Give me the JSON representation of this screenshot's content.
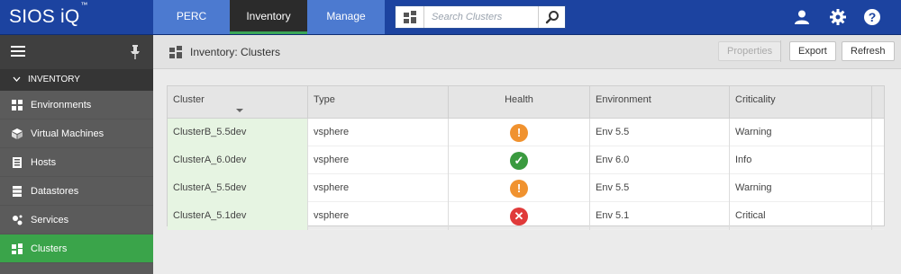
{
  "app": {
    "brand": "SIOS iQ",
    "brand_tm": "™"
  },
  "nav": {
    "tabs": [
      {
        "label": "PERC"
      },
      {
        "label": "Inventory"
      },
      {
        "label": "Manage"
      }
    ]
  },
  "search": {
    "placeholder": "Search Clusters"
  },
  "sidebar": {
    "section": "INVENTORY",
    "items": [
      {
        "label": "Environments",
        "icon": "environments-icon"
      },
      {
        "label": "Virtual Machines",
        "icon": "virtual-machine-icon"
      },
      {
        "label": "Hosts",
        "icon": "host-icon"
      },
      {
        "label": "Datastores",
        "icon": "datastore-icon"
      },
      {
        "label": "Services",
        "icon": "services-icon"
      },
      {
        "label": "Clusters",
        "icon": "cluster-icon",
        "active": true
      }
    ]
  },
  "page": {
    "title": "Inventory: Clusters",
    "buttons": {
      "properties": "Properties",
      "export": "Export",
      "refresh": "Refresh"
    }
  },
  "table": {
    "columns": [
      "Cluster",
      "Type",
      "Health",
      "Environment",
      "Criticality"
    ],
    "rows": [
      {
        "cluster": "ClusterB_5.5dev",
        "type": "vsphere",
        "health": "warning",
        "environment": "Env 5.5",
        "criticality": "Warning"
      },
      {
        "cluster": "ClusterA_6.0dev",
        "type": "vsphere",
        "health": "ok",
        "environment": "Env 6.0",
        "criticality": "Info"
      },
      {
        "cluster": "ClusterA_5.5dev",
        "type": "vsphere",
        "health": "warning",
        "environment": "Env 5.5",
        "criticality": "Warning"
      },
      {
        "cluster": "ClusterA_5.1dev",
        "type": "vsphere",
        "health": "critical",
        "environment": "Env 5.1",
        "criticality": "Critical"
      }
    ]
  },
  "colors": {
    "topbar": "#1c43a0",
    "tab": "#4c7ad0",
    "active_tab": "#2b2b2b",
    "accent_green": "#3aa44a",
    "warning": "#f0922f",
    "ok": "#3a9a3f",
    "critical": "#e03a3a"
  }
}
